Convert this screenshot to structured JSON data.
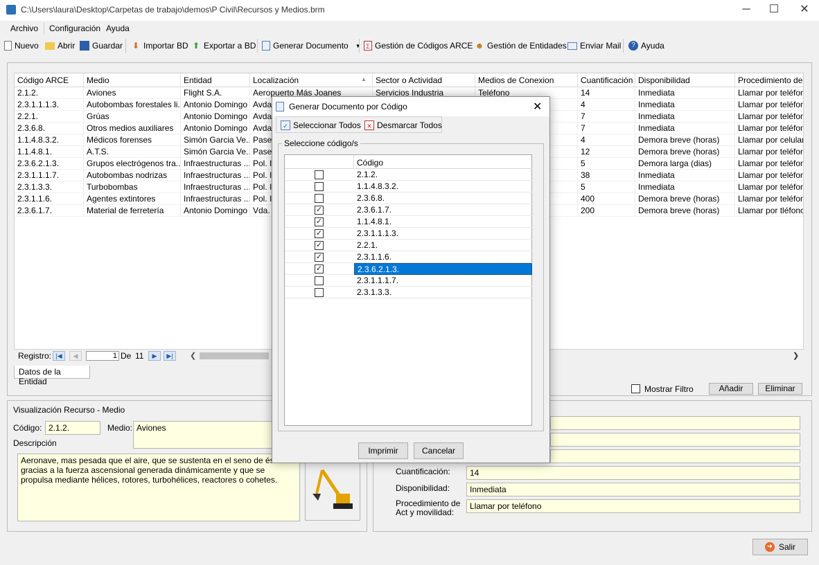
{
  "window": {
    "title": "C:\\Users\\laura\\Desktop\\Carpetas de trabajo\\demos\\P Civil\\Recursos y Medios.brm",
    "minimize": "─",
    "maximize": "☐",
    "close": "✕"
  },
  "menu": [
    "Archivo",
    "Configuración",
    "Ayuda"
  ],
  "toolbar": {
    "nuevo": "Nuevo",
    "abrir": "Abrir",
    "guardar": "Guardar",
    "importar": "Importar BD",
    "exportar": "Exportar a BD",
    "generar": "Generar Documento",
    "gestion_codigos": "Gestión de Códigos ARCE",
    "gestion_entidades": "Gestión de Entidades",
    "enviar_mail": "Enviar Mail",
    "ayuda": "Ayuda"
  },
  "grid": {
    "columns": [
      "Código ARCE",
      "Medio",
      "Entidad",
      "Localización",
      "Sector o Actividad",
      "Medios de Conexion",
      "Cuantificación",
      "Disponibilidad",
      "Procedimiento de"
    ],
    "rows": [
      [
        "2.1.2.",
        "Aviones",
        "Flight S.A.",
        "Aeropuerto Más Joanes",
        "Servicios Industria",
        "Teléfono",
        "14",
        "Inmediata",
        "Llamar por teléfono"
      ],
      [
        "2.3.1.1.1.3.",
        "Autobombas forestales li...",
        "Antonio Domingo",
        "Avda. ",
        "",
        "",
        "4",
        "Inmediata",
        "Llamar por teléfono"
      ],
      [
        "2.2.1.",
        "Grúas",
        "Antonio Domingo",
        "Avda. ",
        "",
        "",
        "7",
        "Inmediata",
        "Llamar por teléfono"
      ],
      [
        "2.3.6.8.",
        "Otros medios auxiliares",
        "Antonio Domingo",
        "Avda. ",
        "",
        "",
        "7",
        "Inmediata",
        "Llamar por teléfono"
      ],
      [
        "1.1.4.8.3.2.",
        "Médicos forenses",
        "Simón Garcia Ve...",
        "Paseo",
        "",
        "",
        "4",
        "Demora breve (horas)",
        "Llamar por celular"
      ],
      [
        "1.1.4.8.1.",
        "A.T.S.",
        "Simón Garcia Ve...",
        "Paseo",
        "",
        "",
        "12",
        "Demora breve (horas)",
        "Llamar por teléfono"
      ],
      [
        "2.3.6.2.1.3.",
        "Grupos electrógenos tra...",
        "Infraestructuras ...",
        "Pol. In",
        "",
        "",
        "5",
        "Demora larga (dias)",
        "Llamar por teléfono"
      ],
      [
        "2.3.1.1.1.7.",
        "Autobombas nodrizas",
        "Infraestructuras ...",
        "Pol. In",
        "",
        "",
        "38",
        "Inmediata",
        "Llamar por teléfono"
      ],
      [
        "2.3.1.3.3.",
        "Turbobombas",
        "Infraestructuras ...",
        "Pol. In",
        "",
        "",
        "5",
        "Inmediata",
        "Llamar por teléfono"
      ],
      [
        "2.3.1.1.6.",
        "Agentes extintores",
        "Infraestructuras ...",
        "Pol. In",
        "",
        "",
        "400",
        "Demora breve (horas)",
        "Llamar por teléfono"
      ],
      [
        "2.3.6.1.7.",
        "Material de ferretería",
        "Antonio Domingo",
        "Vda. S",
        "",
        "",
        "200",
        "Demora breve (horas)",
        "Llamar por tléfono"
      ]
    ]
  },
  "nav": {
    "label": "Registro:",
    "current": "1",
    "of": "De",
    "total": "11"
  },
  "tab": "Datos de la Entidad",
  "filter": {
    "mostrar": "Mostrar Filtro",
    "anadir": "Añadir",
    "eliminar": "Eliminar"
  },
  "recurso": {
    "group": "Visualización Recurso - Medio",
    "codigo_label": "Código:",
    "codigo": "2.1.2.",
    "medio_label": "Medio:",
    "medio": "Aviones",
    "descripcion_label": "Descripción",
    "descripcion": "Aeronave, mas pesada que el aire, que se sustenta en el seno de éste gracias a la fuerza ascensional generada dinámicamente y que se propulsa mediante hélices, rotores, turbohélices, reactores o cohetes."
  },
  "detalle": {
    "cuantificacion_label": "Cuantificación:",
    "cuantificacion": "14",
    "disponibilidad_label": "Disponibilidad:",
    "disponibilidad": "Inmediata",
    "procedimiento_label": "Procedimiento de Act y movilidad:",
    "procedimiento": "Llamar por teléfono"
  },
  "salir": "Salir",
  "dialog": {
    "title": "Generar Documento por Código",
    "seleccionar": "Seleccionar Todos",
    "desmarcar": "Desmarcar Todos",
    "group": "Seleccione código/s",
    "col": "Código",
    "rows": [
      {
        "code": "2.1.2.",
        "checked": false
      },
      {
        "code": "1.1.4.8.3.2.",
        "checked": false
      },
      {
        "code": "2.3.6.8.",
        "checked": false
      },
      {
        "code": "2.3.6.1.7.",
        "checked": true
      },
      {
        "code": "1.1.4.8.1.",
        "checked": true
      },
      {
        "code": "2.3.1.1.1.3.",
        "checked": true
      },
      {
        "code": "2.2.1.",
        "checked": true
      },
      {
        "code": "2.3.1.1.6.",
        "checked": true
      },
      {
        "code": "2.3.6.2.1.3.",
        "checked": true,
        "selected": true
      },
      {
        "code": "2.3.1.1.1.7.",
        "checked": false
      },
      {
        "code": "2.3.1.3.3.",
        "checked": false
      }
    ],
    "imprimir": "Imprimir",
    "cancelar": "Cancelar"
  },
  "colors": {
    "selection": "#0078d7",
    "yellow_field": "#ffffe1"
  }
}
